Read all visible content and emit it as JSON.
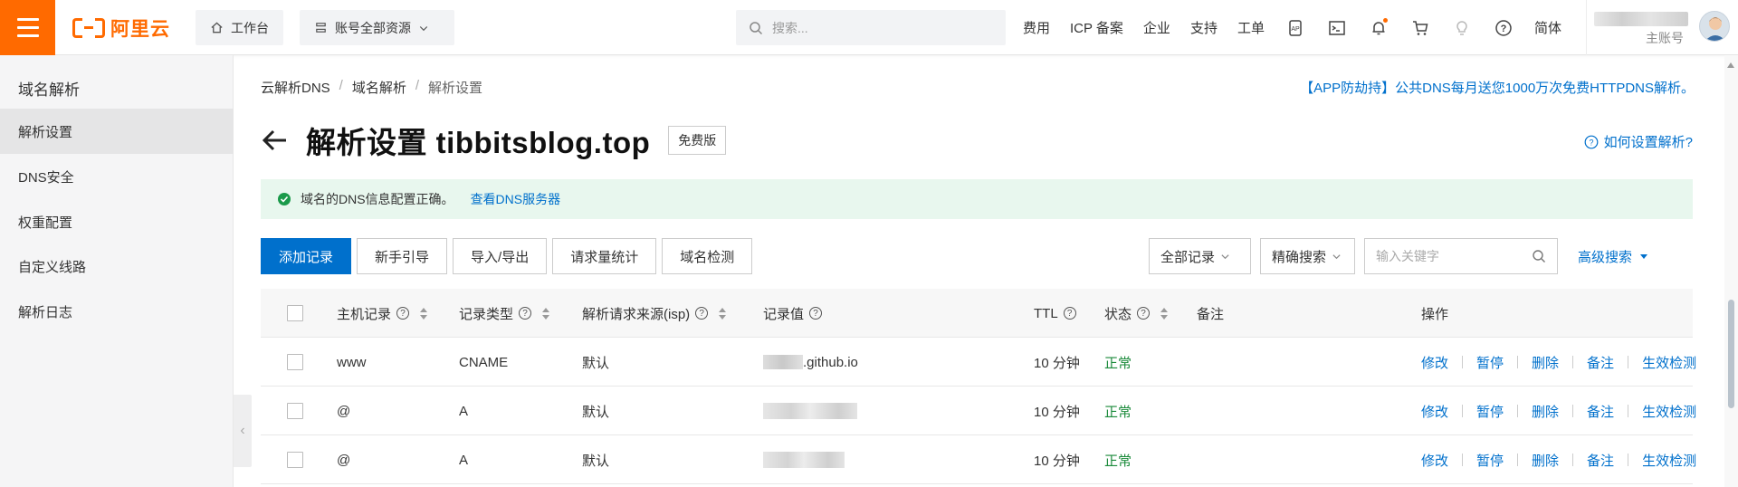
{
  "topbar": {
    "logo_text": "阿里云",
    "workbench": "工作台",
    "resources": "账号全部资源",
    "search_placeholder": "搜索...",
    "links": [
      "费用",
      "ICP 备案",
      "企业",
      "支持",
      "工单"
    ],
    "lang": "简体",
    "account_label": "主账号"
  },
  "sidebar": {
    "title": "域名解析",
    "items": [
      "解析设置",
      "DNS安全",
      "权重配置",
      "自定义线路",
      "解析日志"
    ]
  },
  "breadcrumb": [
    "云解析DNS",
    "域名解析",
    "解析设置"
  ],
  "promo": "【APP防劫持】公共DNS每月送您1000万次免费HTTPDNS解析。",
  "page": {
    "title": "解析设置 tibbitsblog.top",
    "edition_tag": "免费版",
    "help_link": "如何设置解析?"
  },
  "alert": {
    "message": "域名的DNS信息配置正确。",
    "link": "查看DNS服务器"
  },
  "toolbar": {
    "buttons": [
      "添加记录",
      "新手引导",
      "导入/导出",
      "请求量统计",
      "域名检测"
    ],
    "filter_all": "全部记录",
    "filter_exact": "精确搜索",
    "keyword_placeholder": "输入关键字",
    "advanced": "高级搜索"
  },
  "table": {
    "headers": {
      "host": "主机记录",
      "type": "记录类型",
      "isp": "解析请求来源(isp)",
      "value": "记录值",
      "ttl": "TTL",
      "status": "状态",
      "remark": "备注",
      "ops": "操作"
    },
    "rows": [
      {
        "host": "www",
        "type": "CNAME",
        "isp": "默认",
        "value": ".github.io",
        "ttl": "10 分钟",
        "status": "正常"
      },
      {
        "host": "@",
        "type": "A",
        "isp": "默认",
        "value": "",
        "ttl": "10 分钟",
        "status": "正常"
      },
      {
        "host": "@",
        "type": "A",
        "isp": "默认",
        "value": "",
        "ttl": "10 分钟",
        "status": "正常"
      }
    ],
    "ops": [
      "修改",
      "暂停",
      "删除",
      "备注",
      "生效检测"
    ]
  },
  "colors": {
    "brand": "#ff6a00",
    "primary": "#0070cc",
    "success": "#1a8a3a",
    "alert_bg": "#e8f7ee"
  }
}
